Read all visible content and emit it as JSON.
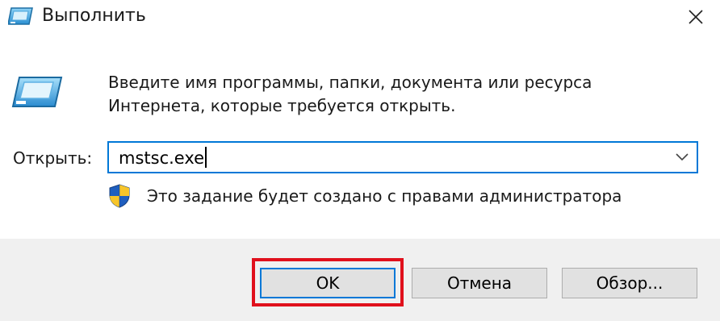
{
  "window": {
    "title": "Выполнить",
    "icon": "run-dialog-icon"
  },
  "body": {
    "description_line1": "Введите имя программы, папки, документа или ресурса",
    "description_line2": "Интернета, которые требуется открыть.",
    "open_label": "Открыть:",
    "open_value": "mstsc.exe",
    "admin_note": "Это задание будет создано с правами администратора"
  },
  "buttons": {
    "ok": "OK",
    "cancel": "Отмена",
    "browse": "Обзор..."
  },
  "colors": {
    "focus_blue": "#0078d7",
    "highlight_red": "#e0101c",
    "footer_bg": "#f0f0f0",
    "button_bg": "#e1e1e1"
  }
}
